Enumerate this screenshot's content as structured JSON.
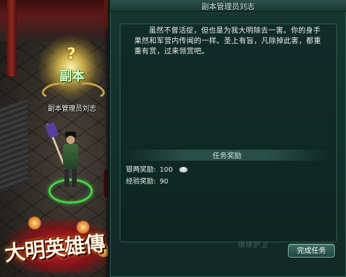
{
  "world": {
    "npc_badge": "副本",
    "quest_mark": "?",
    "npc_name": "副本管理员刘志",
    "game_logo": "大明英雄傳"
  },
  "dialog": {
    "title": "副本管理员刘志",
    "close_glyph": "×",
    "body": "虽然不曾活捉，但也是为我大明除去一害。你的身手果然和军营内传闻的一样。圣上有旨，凡除掉此害，都重重有赏，过来领赏吧。",
    "reward_header": "任务奖励",
    "rewards": {
      "silver_label": "银两奖励:",
      "silver_value": "100",
      "exp_label": "经验奖励:",
      "exp_value": "90"
    },
    "ghost_label": "继续护卫",
    "complete_button": "完成任务"
  },
  "colors": {
    "panel_bg": "#13302b",
    "panel_border": "#2f5a52",
    "button_bg": "#2a5a52",
    "selection_ring": "#4cd24c",
    "quest_glow": "#ffe070"
  }
}
